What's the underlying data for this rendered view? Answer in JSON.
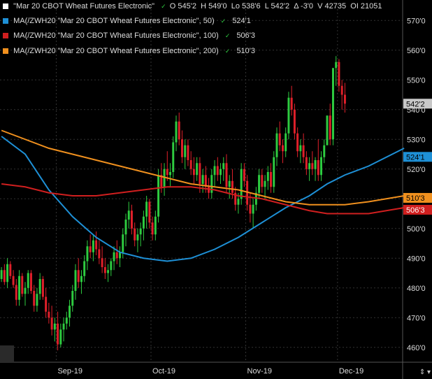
{
  "quote": {
    "symbol": "\"Mar 20 CBOT Wheat Futures Electronic\"",
    "open": "O 545'2",
    "high": "H 549'0",
    "low": "Lo 538'6",
    "last": "L 542'2",
    "change": "Δ -3'0",
    "volume": "V 42735",
    "oi": "OI 21051",
    "indicator": "✓",
    "square_color": "#ffffff"
  },
  "legends": [
    {
      "name": "MA(/ZWH20 \"Mar 20 CBOT Wheat Futures Electronic\", 50)",
      "value": "524'1",
      "color": "#1e90d6"
    },
    {
      "name": "MA(/ZWH20 \"Mar 20 CBOT Wheat Futures Electronic\", 100)",
      "value": "506'3",
      "color": "#d01f1f"
    },
    {
      "name": "MA(/ZWH20 \"Mar 20 CBOT Wheat Futures Electronic\", 200)",
      "value": "510'3",
      "color": "#f0901e"
    }
  ],
  "controls": {
    "axis_toggle": "⇕ ▾"
  },
  "colors": {
    "up": "#2ecc40",
    "down": "#e0202a",
    "grid": "#333333",
    "last_label_bg": "#c8c8c8"
  },
  "chart_data": {
    "type": "candlestick",
    "title": "Mar 20 CBOT Wheat Futures Electronic",
    "ylim": [
      455,
      575
    ],
    "y_ticks": [
      460,
      470,
      480,
      490,
      500,
      510,
      520,
      530,
      540,
      550,
      560,
      570
    ],
    "y_tick_labels": [
      "460'0",
      "470'0",
      "480'0",
      "490'0",
      "500'0",
      "510'0",
      "520'0",
      "530'0",
      "540'0",
      "550'0",
      "560'0",
      "570'0"
    ],
    "x_labels": [
      {
        "label": "Sep-19",
        "bar": 19
      },
      {
        "label": "Oct-19",
        "bar": 51
      },
      {
        "label": "Nov-19",
        "bar": 83
      },
      {
        "label": "Dec-19",
        "bar": 114
      }
    ],
    "bar_count": 136,
    "candles": [
      [
        483,
        487,
        482,
        486
      ],
      [
        486,
        488,
        481,
        482
      ],
      [
        482,
        490,
        480,
        488
      ],
      [
        488,
        489,
        483,
        484
      ],
      [
        484,
        486,
        480,
        481
      ],
      [
        481,
        483,
        474,
        476
      ],
      [
        476,
        486,
        474,
        484
      ],
      [
        484,
        485,
        477,
        478
      ],
      [
        478,
        482,
        474,
        480
      ],
      [
        480,
        486,
        478,
        485
      ],
      [
        485,
        486,
        478,
        479
      ],
      [
        479,
        481,
        472,
        474
      ],
      [
        474,
        480,
        472,
        478
      ],
      [
        478,
        485,
        476,
        483
      ],
      [
        483,
        484,
        476,
        477
      ],
      [
        477,
        480,
        470,
        472
      ],
      [
        472,
        475,
        468,
        470
      ],
      [
        470,
        474,
        464,
        466
      ],
      [
        466,
        470,
        462,
        468
      ],
      [
        468,
        472,
        459,
        461
      ],
      [
        461,
        468,
        460,
        466
      ],
      [
        466,
        470,
        462,
        468
      ],
      [
        468,
        472,
        466,
        470
      ],
      [
        470,
        476,
        467,
        474
      ],
      [
        474,
        481,
        472,
        479
      ],
      [
        479,
        488,
        476,
        486
      ],
      [
        486,
        490,
        480,
        482
      ],
      [
        482,
        486,
        478,
        484
      ],
      [
        484,
        491,
        482,
        489
      ],
      [
        489,
        496,
        486,
        494
      ],
      [
        494,
        498,
        490,
        492
      ],
      [
        492,
        498,
        489,
        496
      ],
      [
        496,
        499,
        491,
        493
      ],
      [
        493,
        496,
        488,
        490
      ],
      [
        490,
        494,
        485,
        487
      ],
      [
        487,
        490,
        483,
        485
      ],
      [
        485,
        488,
        482,
        486
      ],
      [
        486,
        490,
        484,
        489
      ],
      [
        489,
        494,
        486,
        492
      ],
      [
        492,
        496,
        488,
        490
      ],
      [
        490,
        494,
        487,
        492
      ],
      [
        492,
        500,
        490,
        498
      ],
      [
        498,
        505,
        494,
        503
      ],
      [
        503,
        509,
        500,
        506
      ],
      [
        506,
        508,
        498,
        500
      ],
      [
        500,
        502,
        494,
        496
      ],
      [
        496,
        500,
        492,
        498
      ],
      [
        498,
        502,
        494,
        500
      ],
      [
        500,
        506,
        496,
        504
      ],
      [
        504,
        511,
        500,
        509
      ],
      [
        509,
        510,
        500,
        502
      ],
      [
        502,
        504,
        496,
        498
      ],
      [
        498,
        506,
        496,
        504
      ],
      [
        504,
        520,
        502,
        518
      ],
      [
        518,
        522,
        512,
        514
      ],
      [
        514,
        522,
        511,
        520
      ],
      [
        520,
        526,
        516,
        518
      ],
      [
        518,
        522,
        514,
        519
      ],
      [
        519,
        531,
        517,
        529
      ],
      [
        529,
        538,
        526,
        536
      ],
      [
        536,
        539,
        528,
        530
      ],
      [
        530,
        533,
        522,
        524
      ],
      [
        524,
        530,
        520,
        528
      ],
      [
        528,
        530,
        521,
        523
      ],
      [
        523,
        526,
        518,
        520
      ],
      [
        520,
        524,
        515,
        518
      ],
      [
        518,
        524,
        516,
        522
      ],
      [
        522,
        524,
        512,
        515
      ],
      [
        515,
        520,
        512,
        518
      ],
      [
        518,
        521,
        512,
        514
      ],
      [
        514,
        517,
        510,
        512
      ],
      [
        512,
        520,
        510,
        518
      ],
      [
        518,
        523,
        514,
        521
      ],
      [
        521,
        524,
        516,
        518
      ],
      [
        518,
        522,
        515,
        520
      ],
      [
        520,
        524,
        516,
        522
      ],
      [
        522,
        525,
        512,
        514
      ],
      [
        514,
        518,
        510,
        516
      ],
      [
        516,
        520,
        510,
        512
      ],
      [
        512,
        514,
        506,
        508
      ],
      [
        508,
        512,
        505,
        510
      ],
      [
        510,
        522,
        508,
        520
      ],
      [
        520,
        522,
        514,
        516
      ],
      [
        516,
        518,
        506,
        508
      ],
      [
        508,
        512,
        502,
        505
      ],
      [
        505,
        510,
        500,
        508
      ],
      [
        508,
        514,
        506,
        512
      ],
      [
        512,
        520,
        510,
        518
      ],
      [
        518,
        520,
        512,
        514
      ],
      [
        514,
        518,
        510,
        516
      ],
      [
        516,
        521,
        513,
        519
      ],
      [
        519,
        522,
        512,
        514
      ],
      [
        514,
        526,
        512,
        524
      ],
      [
        524,
        534,
        521,
        532
      ],
      [
        532,
        536,
        526,
        528
      ],
      [
        528,
        530,
        522,
        526
      ],
      [
        526,
        534,
        524,
        532
      ],
      [
        532,
        546,
        530,
        544
      ],
      [
        544,
        548,
        538,
        540
      ],
      [
        540,
        542,
        530,
        532
      ],
      [
        532,
        534,
        524,
        526
      ],
      [
        526,
        530,
        522,
        528
      ],
      [
        528,
        532,
        522,
        524
      ],
      [
        524,
        526,
        518,
        520
      ],
      [
        520,
        524,
        516,
        522
      ],
      [
        522,
        526,
        518,
        520
      ],
      [
        520,
        524,
        516,
        523
      ],
      [
        523,
        530,
        516,
        518
      ],
      [
        518,
        526,
        516,
        524
      ],
      [
        524,
        530,
        522,
        528
      ],
      [
        528,
        534,
        538,
        538
      ],
      [
        538,
        542,
        528,
        530
      ],
      [
        530,
        549,
        528,
        554
      ],
      [
        554,
        558,
        548,
        556
      ],
      [
        556,
        557,
        546,
        548
      ],
      [
        548,
        550,
        540,
        545
      ],
      [
        545,
        549,
        539,
        542
      ]
    ],
    "series": [
      {
        "name": "MA 50",
        "last": 524.1,
        "color": "#1e90d6",
        "values": [
          [
            0,
            531
          ],
          [
            8,
            525
          ],
          [
            16,
            513
          ],
          [
            24,
            504
          ],
          [
            32,
            497
          ],
          [
            40,
            492
          ],
          [
            48,
            490
          ],
          [
            56,
            489
          ],
          [
            64,
            490
          ],
          [
            72,
            493
          ],
          [
            80,
            497
          ],
          [
            88,
            502
          ],
          [
            96,
            507
          ],
          [
            104,
            511
          ],
          [
            110,
            515
          ],
          [
            116,
            518
          ],
          [
            124,
            521
          ],
          [
            130,
            524
          ],
          [
            136,
            527
          ]
        ]
      },
      {
        "name": "MA 100",
        "last": 506.3,
        "color": "#d01f1f",
        "values": [
          [
            0,
            515
          ],
          [
            8,
            514
          ],
          [
            16,
            512
          ],
          [
            24,
            511
          ],
          [
            32,
            511
          ],
          [
            40,
            512
          ],
          [
            48,
            513
          ],
          [
            56,
            514
          ],
          [
            64,
            514
          ],
          [
            72,
            513
          ],
          [
            80,
            511
          ],
          [
            88,
            510
          ],
          [
            96,
            508
          ],
          [
            104,
            506
          ],
          [
            110,
            505
          ],
          [
            116,
            505
          ],
          [
            124,
            505
          ],
          [
            130,
            506
          ],
          [
            136,
            507
          ]
        ]
      },
      {
        "name": "MA 200",
        "last": 510.3,
        "color": "#f0901e",
        "values": [
          [
            0,
            533
          ],
          [
            8,
            530
          ],
          [
            16,
            527
          ],
          [
            24,
            525
          ],
          [
            32,
            523
          ],
          [
            40,
            521
          ],
          [
            48,
            519
          ],
          [
            56,
            517
          ],
          [
            64,
            515
          ],
          [
            72,
            514
          ],
          [
            80,
            513
          ],
          [
            88,
            511
          ],
          [
            96,
            509
          ],
          [
            104,
            508
          ],
          [
            110,
            508
          ],
          [
            116,
            508
          ],
          [
            124,
            509
          ],
          [
            130,
            510
          ],
          [
            136,
            511
          ]
        ]
      }
    ],
    "last_price_label": "542'2",
    "ma_labels": [
      {
        "text": "524'1",
        "value": 524.1,
        "color": "#1e90d6",
        "text_color": "#000000"
      },
      {
        "text": "510'3",
        "value": 510.3,
        "color": "#f0901e",
        "text_color": "#000000"
      },
      {
        "text": "506'3",
        "value": 506.3,
        "color": "#d01f1f",
        "text_color": "#ffffff"
      }
    ]
  }
}
